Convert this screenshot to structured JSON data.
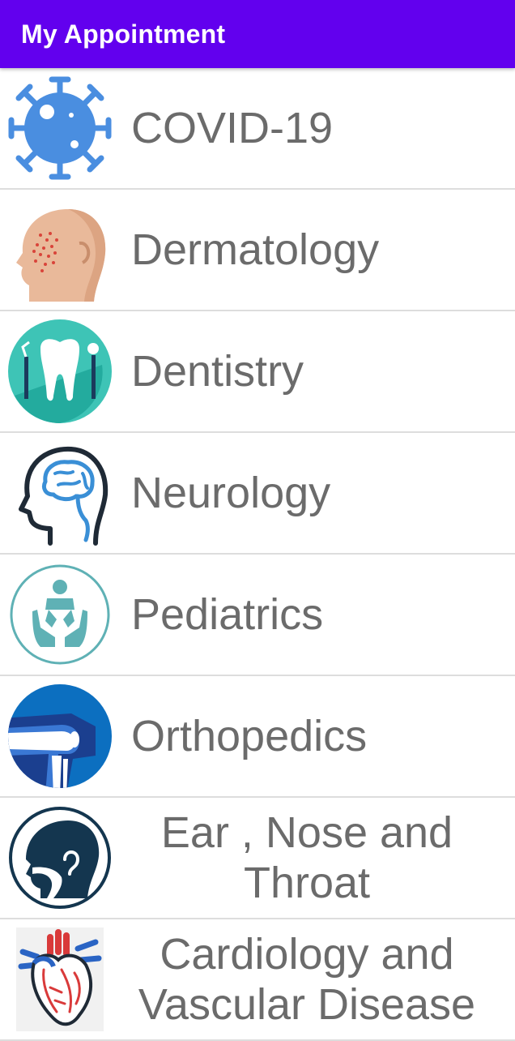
{
  "app": {
    "title": "My Appointment",
    "accent": "#6200ee"
  },
  "departments": [
    {
      "label": "COVID-19",
      "icon": "virus-icon"
    },
    {
      "label": "Dermatology",
      "icon": "face-rash-icon"
    },
    {
      "label": "Dentistry",
      "icon": "tooth-icon"
    },
    {
      "label": "Neurology",
      "icon": "brain-head-icon"
    },
    {
      "label": "Pediatrics",
      "icon": "child-hands-icon"
    },
    {
      "label": "Orthopedics",
      "icon": "knee-joint-icon"
    },
    {
      "label": "Ear , Nose and Throat",
      "icon": "ent-head-icon"
    },
    {
      "label": "Cardiology and Vascular Disease",
      "icon": "heart-icon"
    }
  ]
}
